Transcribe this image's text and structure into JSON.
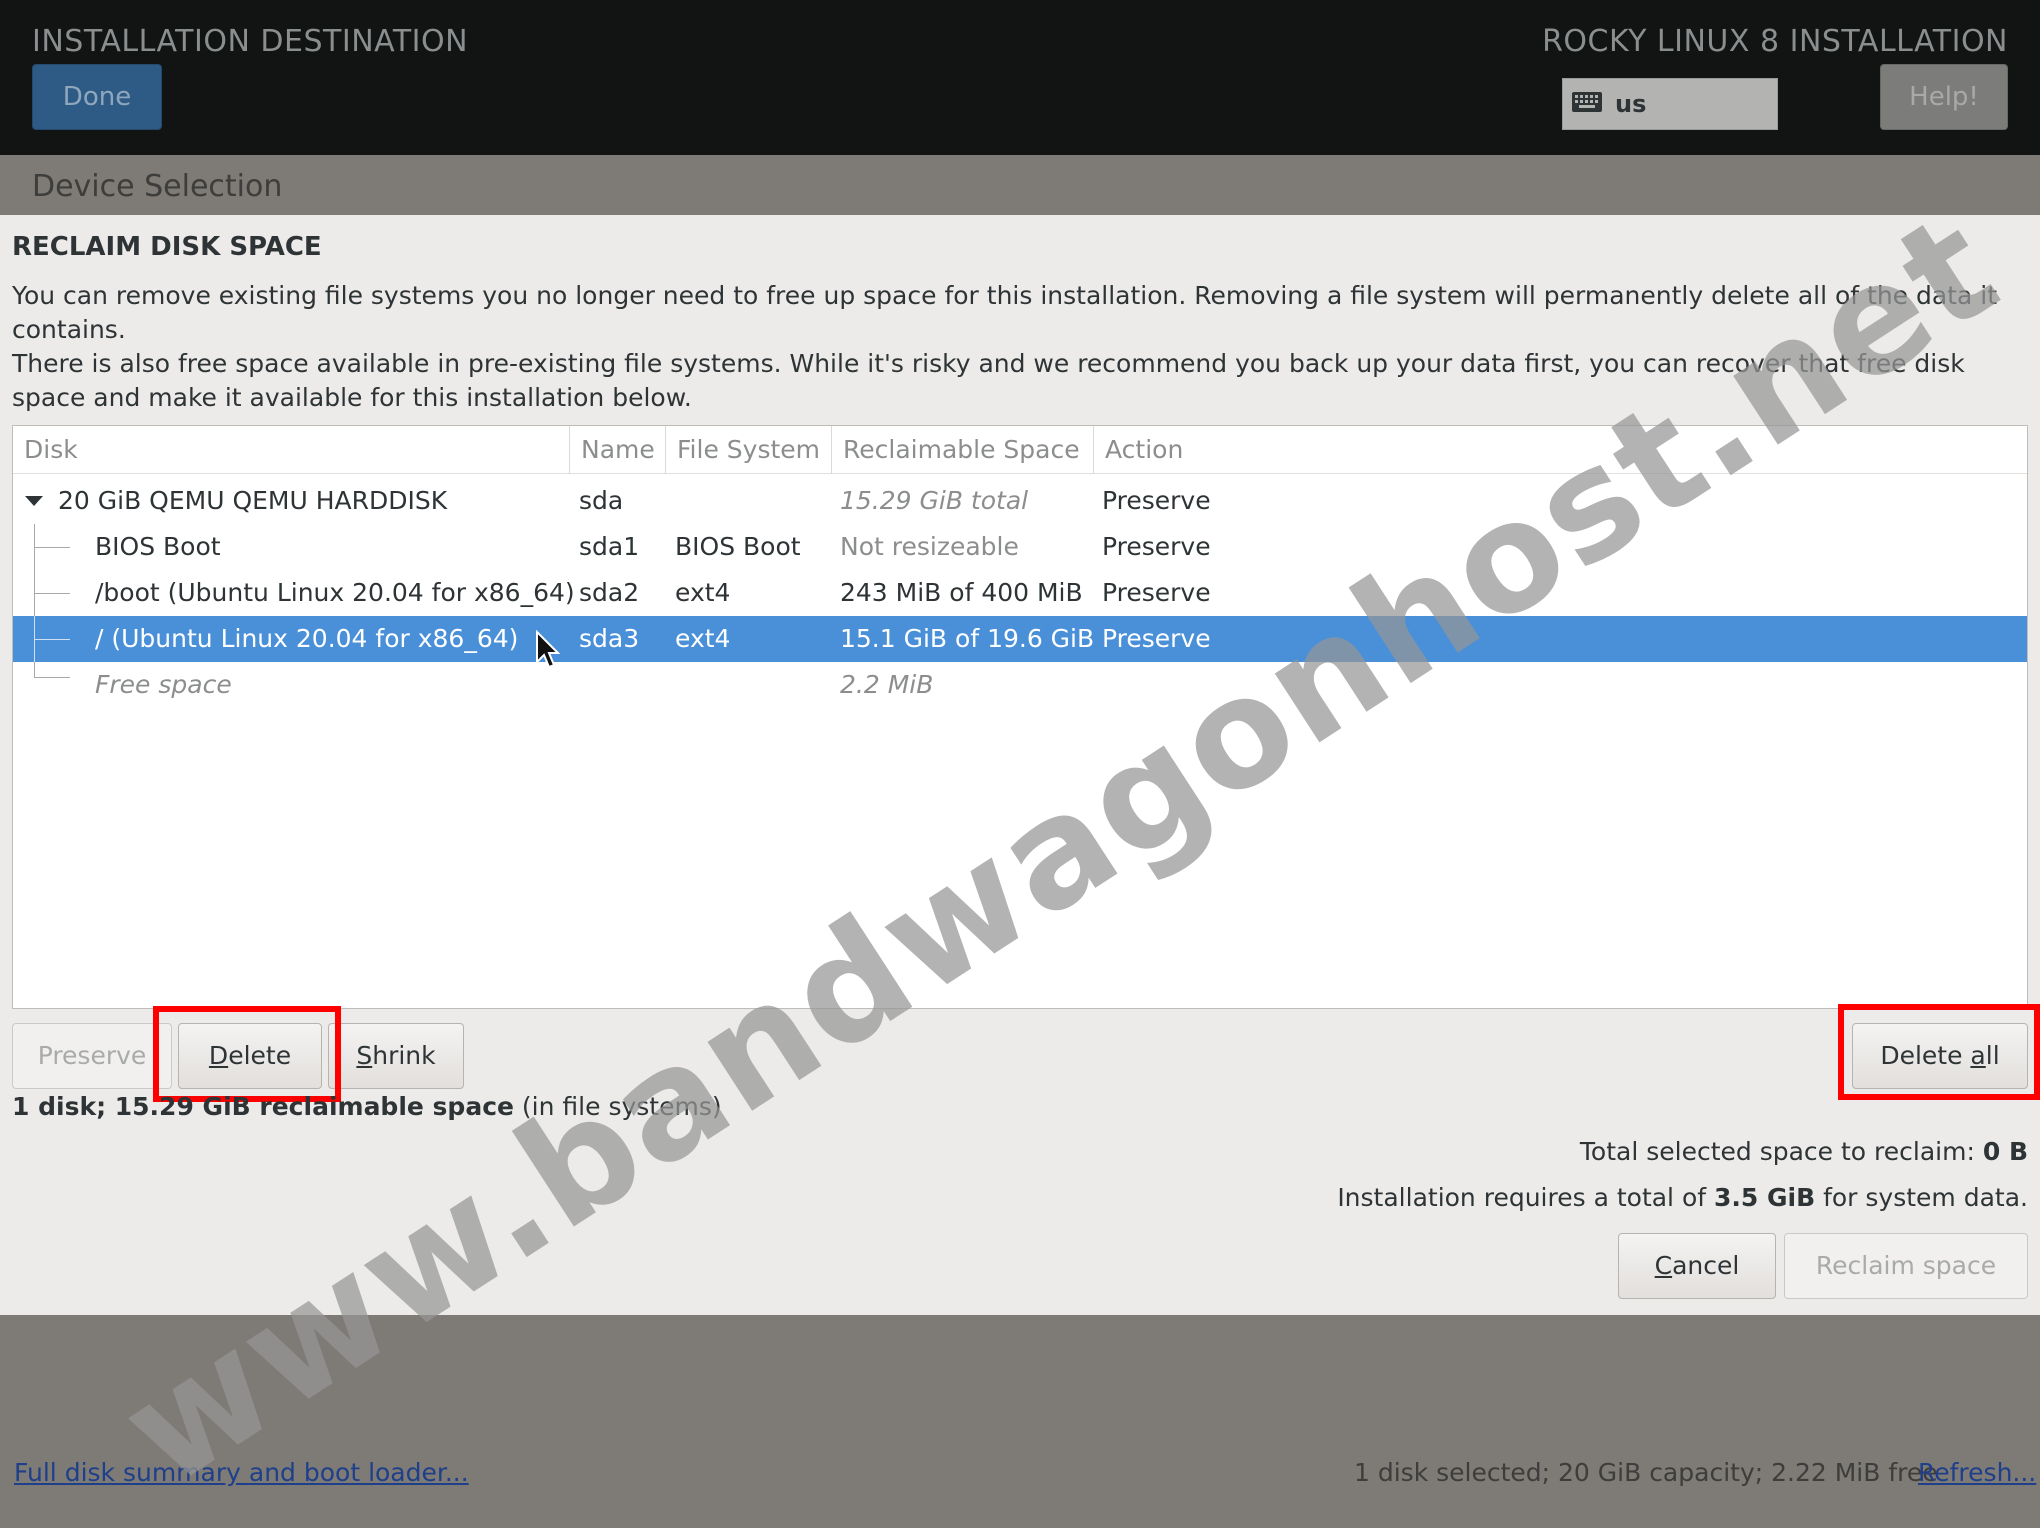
{
  "header": {
    "title": "INSTALLATION DESTINATION",
    "product": "ROCKY LINUX 8 INSTALLATION",
    "done_label": "Done",
    "keyboard_layout": "us",
    "help_label": "Help!"
  },
  "strip": {
    "label": "Device Selection"
  },
  "dialog": {
    "title": "RECLAIM DISK SPACE",
    "desc1": "You can remove existing file systems you no longer need to free up space for this installation.  Removing a file system will permanently delete all of the data it contains.",
    "desc2": "There is also free space available in pre-existing file systems.  While it's risky and we recommend you back up your data first, you can recover that free disk space and make it available for this installation below.",
    "table": {
      "columns": [
        "Disk",
        "Name",
        "File System",
        "Reclaimable Space",
        "Action"
      ],
      "rows": [
        {
          "disk": "20 GiB QEMU QEMU HARDDISK",
          "name": "sda",
          "fs": "",
          "space": "15.29 GiB total",
          "action": "Preserve"
        },
        {
          "disk": "BIOS Boot",
          "name": "sda1",
          "fs": "BIOS Boot",
          "space": "Not resizeable",
          "action": "Preserve"
        },
        {
          "disk": "/boot (Ubuntu Linux 20.04 for x86_64)",
          "name": "sda2",
          "fs": "ext4",
          "space": "243 MiB of 400 MiB",
          "action": "Preserve"
        },
        {
          "disk": "/ (Ubuntu Linux 20.04 for x86_64)",
          "name": "sda3",
          "fs": "ext4",
          "space": "15.1 GiB of 19.6 GiB",
          "action": "Preserve"
        },
        {
          "disk": "Free space",
          "name": "",
          "fs": "",
          "space": "2.2 MiB",
          "action": ""
        }
      ]
    },
    "buttons": {
      "preserve": "Preserve",
      "delete_underline": "D",
      "delete_rest": "elete",
      "shrink_underline": "S",
      "shrink_rest": "hrink",
      "delete_all_pre": "Delete ",
      "delete_all_underline": "a",
      "delete_all_rest": "ll",
      "cancel_underline": "C",
      "cancel_rest": "ancel",
      "reclaim": "Reclaim space"
    },
    "summary": {
      "bold": "1 disk; 15.29 GiB reclaimable space",
      "rest": " (in file systems)"
    },
    "total_selected": {
      "label": "Total selected space to reclaim: ",
      "value": "0 B"
    },
    "requirement": {
      "pre": "Installation requires a total of ",
      "value": "3.5 GiB",
      "post": " for system data."
    }
  },
  "footer": {
    "link": "Full disk summary and boot loader...",
    "status": "1 disk selected; 20 GiB capacity; 2.22 MiB free",
    "refresh": "Refresh..."
  },
  "watermark": "www.bandwagonhost.net",
  "colors": {
    "header_bg": "#121414",
    "selection": "#4a90d9",
    "done_button": "#2e5b85",
    "highlight_box": "#ff0000",
    "link": "#1e3f8a"
  },
  "icons": [
    "keyboard-icon",
    "expander-arrow-icon",
    "mouse-pointer-icon"
  ]
}
